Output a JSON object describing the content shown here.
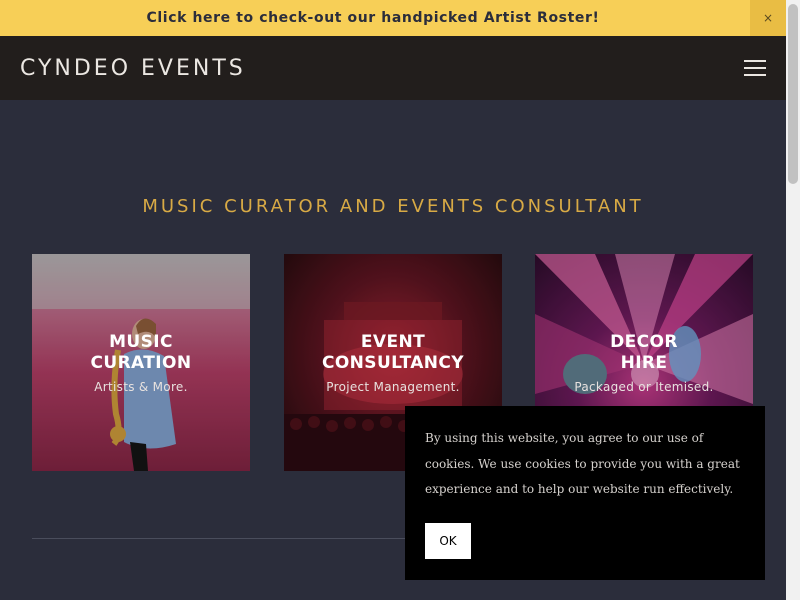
{
  "announcement": {
    "text": "Click here to check-out our handpicked Artist Roster!",
    "close_label": "×"
  },
  "nav": {
    "brand": "CYNDEO EVENTS",
    "menu_icon": "hamburger-menu-icon"
  },
  "hero": {
    "tagline": "MUSIC CURATOR AND EVENTS CONSULTANT"
  },
  "services": [
    {
      "title_line1": "MUSIC",
      "title_line2": "CURATION",
      "subtitle": "Artists & More."
    },
    {
      "title_line1": "EVENT",
      "title_line2": "CONSULTANCY",
      "subtitle": "Project Management."
    },
    {
      "title_line1": "DECOR",
      "title_line2": "HIRE",
      "subtitle": "Packaged or Itemised."
    }
  ],
  "cookie_notice": {
    "text": "By using this website, you agree to our use of cookies. We use cookies to provide you with a great experience and to help our website run effectively.",
    "ok_label": "OK"
  },
  "colors": {
    "announcement_bg": "#f7cf57",
    "nav_bg": "#221e1c",
    "page_bg": "#2b2d3b",
    "accent_gold": "#d8aa45"
  }
}
